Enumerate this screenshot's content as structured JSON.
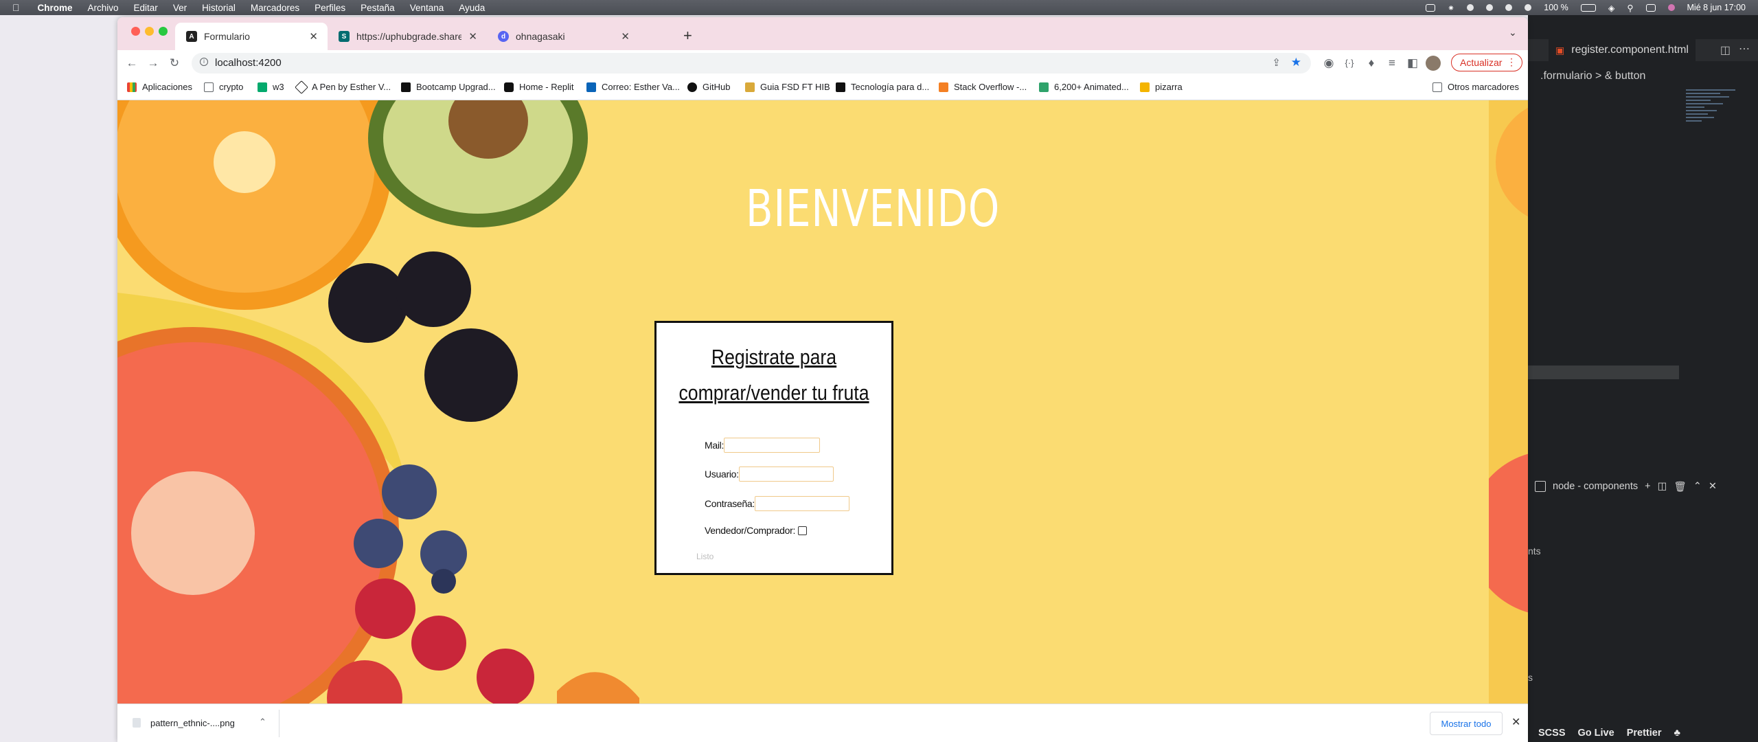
{
  "menubar": {
    "app": "Chrome",
    "items": [
      "Archivo",
      "Editar",
      "Ver",
      "Historial",
      "Marcadores",
      "Perfiles",
      "Pestaña",
      "Ventana",
      "Ayuda"
    ],
    "battery": "100 %",
    "datetime": "Mié 8 jun  17:00"
  },
  "browser": {
    "tabs": [
      {
        "title": "Formulario",
        "active": true
      },
      {
        "title": "https://uphubgrade.sharepoint...",
        "active": false
      },
      {
        "title": "ohnagasaki",
        "active": false
      }
    ],
    "new_tab": "+",
    "url": "localhost:4200",
    "update_label": "Actualizar",
    "bookmarks": [
      "Aplicaciones",
      "crypto",
      "w3",
      "A Pen by Esther V...",
      "Bootcamp Upgrad...",
      "Home - Replit",
      "Correo: Esther Va...",
      "GitHub",
      "Guia FSD FT HIB",
      "Tecnología para d...",
      "Stack Overflow -...",
      "6,200+ Animated...",
      "pizarra"
    ],
    "other_bookmarks": "Otros marcadores"
  },
  "page": {
    "heading": "BIENVENIDO",
    "form": {
      "title_line1": "Registrate para",
      "title_line2": "comprar/vender tu fruta",
      "mail_label": "Mail:",
      "user_label": "Usuario:",
      "password_label": "Contraseña:",
      "role_label": "Vendedor/Comprador:",
      "submit_label": "Listo"
    }
  },
  "downloads": {
    "file": "pattern_ethnic-....png",
    "show_all": "Mostrar todo"
  },
  "editor": {
    "tab": "register.component.html",
    "breadcrumb": ".formulario  >  & button",
    "terminal": "node - components",
    "side_text_1": "nts",
    "side_text_2": "s",
    "status": [
      "SCSS",
      "Go Live",
      "Prettier"
    ]
  },
  "colors": {
    "page_bg": "#fbdc72",
    "tab_strip": "#f4dde6",
    "update_red": "#d93025"
  }
}
